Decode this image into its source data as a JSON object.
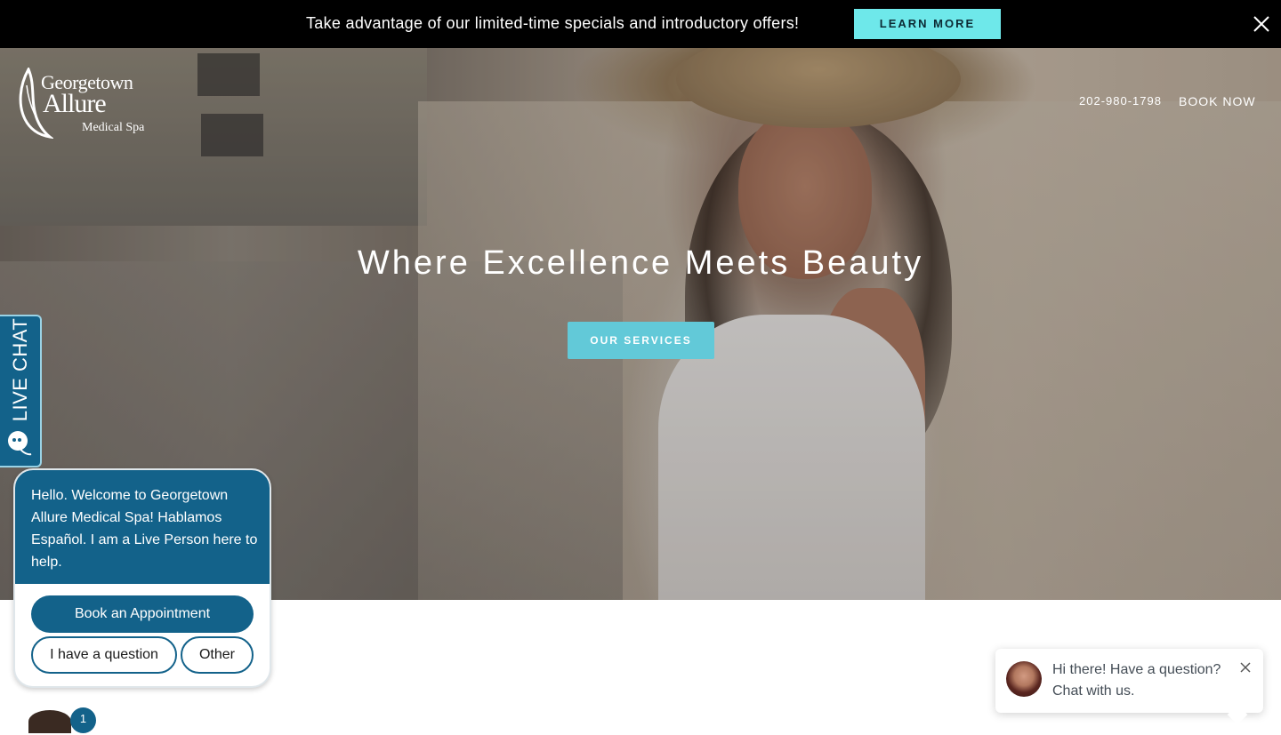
{
  "promo": {
    "text": "Take advantage of our limited-time specials and introductory offers!",
    "button": "LEARN MORE",
    "close_icon": "close-icon"
  },
  "logo": {
    "line1": "Georgetown",
    "line2": "Allure",
    "line3": "Medical Spa",
    "icon": "feather-logo-icon"
  },
  "nav": {
    "phone": "202-980-1798",
    "book": "BOOK NOW"
  },
  "hero": {
    "title": "Where Excellence Meets Beauty",
    "button": "OUR SERVICES"
  },
  "live_tab": {
    "label": "LIVE CHAT",
    "icon": "chat-bubble-icon"
  },
  "chat": {
    "message": "Hello. Welcome to Georgetown Allure Medical Spa! Hablamos Español. I am a Live Person here to help.",
    "options": [
      "Book an Appointment",
      "I have a question",
      "Other"
    ],
    "badge_count": "1"
  },
  "prompt": {
    "text": "Hi there! Have a question? Chat with us.",
    "close_icon": "close-icon"
  },
  "colors": {
    "promo_bg": "#000000",
    "accent_cyan": "#6ee8ea",
    "hero_button": "#62c9d8",
    "chat_blue": "#13628a"
  }
}
